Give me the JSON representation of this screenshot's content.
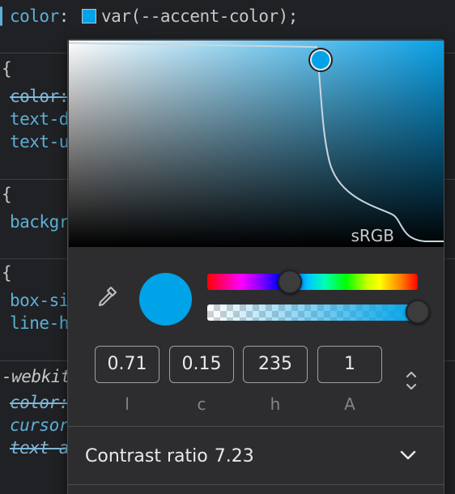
{
  "editor": {
    "top_line": {
      "property": "color",
      "colon": ":",
      "value": "var(--accent-color);"
    },
    "blocks": [
      {
        "brace": "{",
        "lines": [
          {
            "text": "color:",
            "style": "strike"
          },
          {
            "text": "text-d",
            "style": "prop"
          },
          {
            "text": "text-u",
            "style": "prop"
          }
        ]
      },
      {
        "brace": "{",
        "lines": [
          {
            "text": "backgr",
            "style": "prop"
          }
        ]
      },
      {
        "brace": "{",
        "lines": [
          {
            "text": "box-si",
            "style": "prop"
          },
          {
            "text": "line-h",
            "style": "prop"
          }
        ]
      },
      {
        "brace": "-webkit",
        "lines": [
          {
            "text": "color:",
            "style": "strike-ital"
          },
          {
            "text": "cursor",
            "style": "ital"
          },
          {
            "text": "text-a",
            "style": "strike-ital"
          }
        ]
      }
    ]
  },
  "picker": {
    "color_hex": "#00a3e8",
    "gamut_label": "sRGB",
    "eyedropper_icon": "eyedropper-icon",
    "hue_fraction": 0.44,
    "alpha_fraction": 1.0,
    "fields": [
      {
        "value": "0.71",
        "label": "l"
      },
      {
        "value": "0.15",
        "label": "c"
      },
      {
        "value": "235",
        "label": "h"
      },
      {
        "value": "1",
        "label": "A"
      }
    ],
    "format_toggle_icon": "up-down-chevron-icon",
    "contrast": {
      "label": "Contrast ratio",
      "value": "7.23",
      "icon": "chevron-down-icon"
    }
  }
}
